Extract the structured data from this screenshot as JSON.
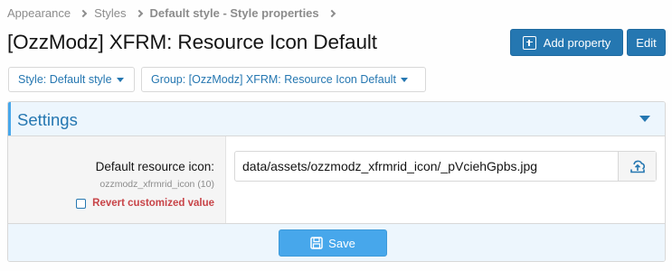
{
  "breadcrumb": {
    "items": [
      "Appearance",
      "Styles",
      "Default style - Style properties"
    ]
  },
  "page": {
    "title": "[OzzModz] XFRM: Resource Icon Default"
  },
  "actions": {
    "add_property_label": "Add property",
    "edit_label": "Edit"
  },
  "filters": {
    "style_label": "Style: Default style",
    "group_label": "Group: [OzzModz] XFRM: Resource Icon Default"
  },
  "settings": {
    "title": "Settings",
    "field": {
      "label": "Default resource icon:",
      "code": "ozzmodz_xfrmrid_icon (10)",
      "revert_label": "Revert customized value",
      "value": "data/assets/ozzmodz_xfrmrid_icon/_pVciehGpbs.jpg"
    },
    "save_label": "Save"
  },
  "colors": {
    "accent": "#2577b1",
    "accent_light": "#47a7eb",
    "header_bg": "#edf6fd",
    "revert_red": "#c84448"
  },
  "icons": {
    "add_property": "plus-square-icon",
    "upload": "upload-icon",
    "save": "floppy-disk-icon",
    "collapse": "caret-down-icon"
  }
}
